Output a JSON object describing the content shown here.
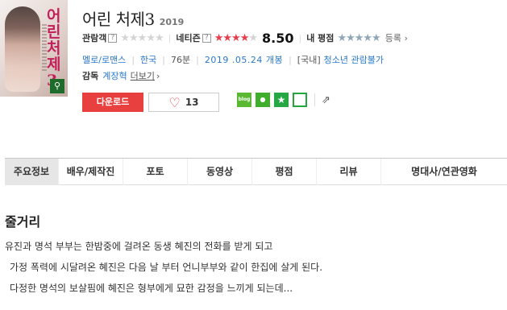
{
  "poster": {
    "title_text": "어린처제3",
    "zoom_icon": "search-icon"
  },
  "movie": {
    "title": "어린 처제3",
    "year": "2019"
  },
  "ratings": {
    "audience_label": "관람객",
    "audience_stars_on": 0,
    "netizen_label": "네티즌",
    "netizen_stars_on": 4,
    "netizen_score": "8.50",
    "my_label": "내 평점",
    "register": "등록"
  },
  "meta": {
    "genre": "멜로/로맨스",
    "country": "한국",
    "runtime": "76분",
    "release": "2019 .05.24 개봉",
    "rating_prefix": "[국내]",
    "rating": "청소년 관람불가"
  },
  "director": {
    "label": "감독",
    "name": "계장혁",
    "more": "더보기"
  },
  "actions": {
    "download": "다운로드",
    "likes": "13"
  },
  "share": {
    "blog": "blog",
    "kakao": "kakao",
    "star": "star",
    "line": "line",
    "share_icon": "share-icon"
  },
  "tabs": [
    {
      "label": "주요정보",
      "active": true
    },
    {
      "label": "배우/제작진",
      "active": false
    },
    {
      "label": "포토",
      "active": false
    },
    {
      "label": "동영상",
      "active": false
    },
    {
      "label": "평점",
      "active": false
    },
    {
      "label": "리뷰",
      "active": false
    },
    {
      "label": "명대사/연관영화",
      "active": false
    }
  ],
  "synopsis": {
    "title": "줄거리",
    "lines": [
      "유진과 명석 부부는 한밤중에 걸려온 동생 혜진의 전화를 받게 되고",
      "가정 폭력에 시달려온 혜진은 다음 날 부터 언니부부와 같이 한집에 살게 된다.",
      "다정한 명석의 보살핌에 혜진은 형부에게 묘한 감정을 느끼게 되는데..."
    ]
  },
  "colors": {
    "accent_red": "#e8403f",
    "link_blue": "#2a78c9"
  }
}
